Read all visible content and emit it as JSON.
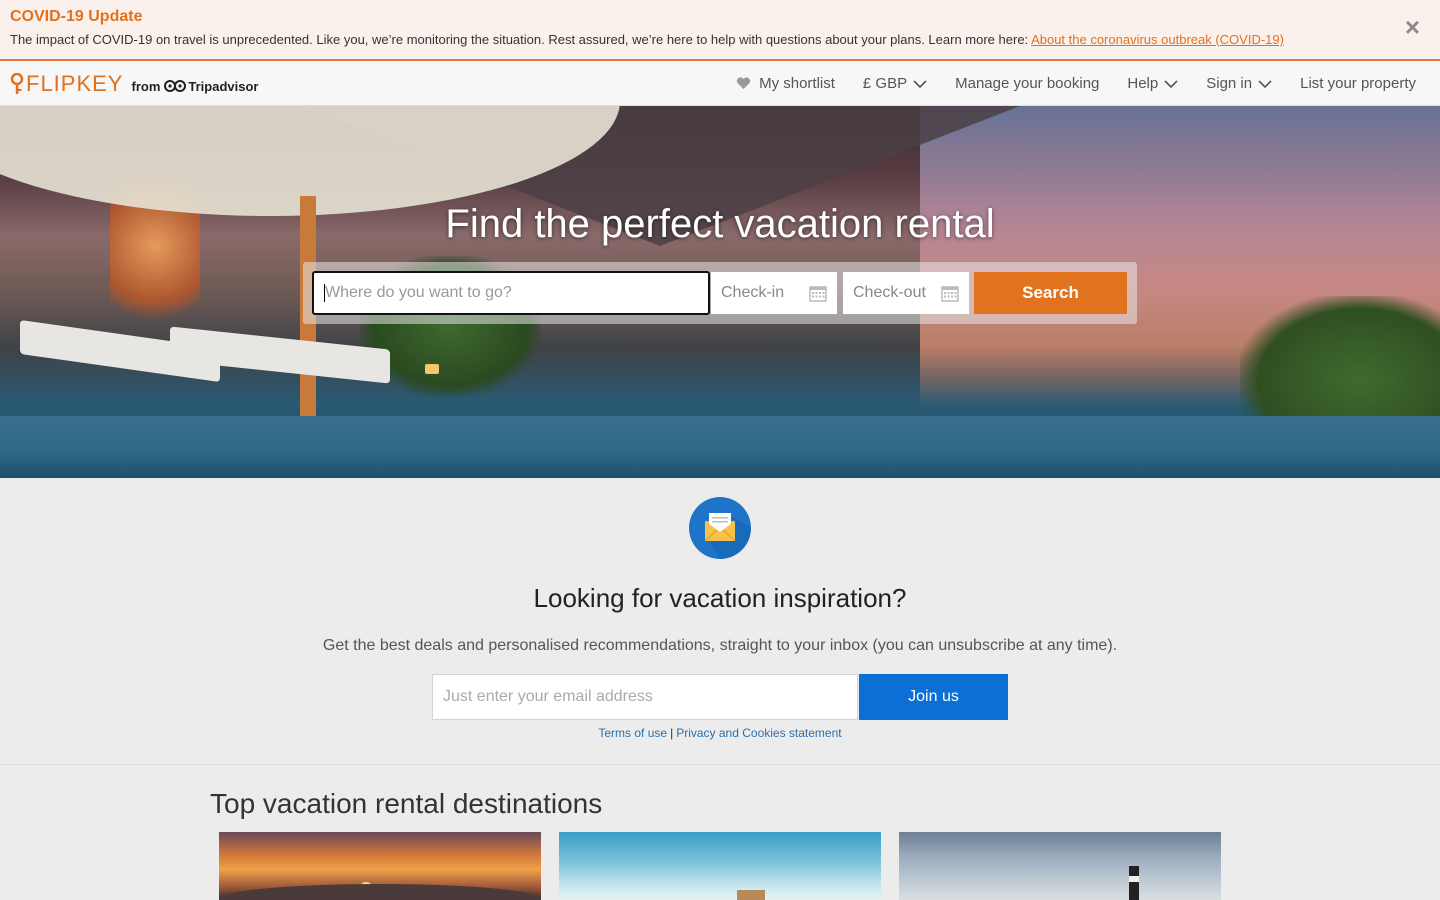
{
  "covid": {
    "title": "COVID-19 Update",
    "text": "The impact of COVID-19 on travel is unprecedented. Like you, we’re monitoring the situation. Rest assured, we’re here to help with questions about your plans. Learn more here: ",
    "link": "About the coronavirus outbreak (COVID-19)",
    "close": "×"
  },
  "header": {
    "logo": "FLIPKEY",
    "logo_from": "from",
    "logo_brand": "Tripadvisor",
    "nav": {
      "shortlist": "My shortlist",
      "currency": "£ GBP",
      "manage": "Manage your booking",
      "help": "Help",
      "signin": "Sign in",
      "list": "List your property"
    }
  },
  "hero": {
    "title": "Find the perfect vacation rental",
    "where_placeholder": "Where do you want to go?",
    "checkin": "Check-in",
    "checkout": "Check-out",
    "search": "Search"
  },
  "newsletter": {
    "title": "Looking for vacation inspiration?",
    "subtitle": "Get the best deals and personalised recommendations, straight to your inbox (you can unsubscribe at any time).",
    "email_placeholder": "Just enter your email address",
    "join": "Join us",
    "terms": "Terms of use",
    "separator": "|",
    "privacy": "Privacy and Cookies statement"
  },
  "destinations": {
    "title": "Top vacation rental destinations"
  },
  "colors": {
    "brand_orange": "#e2731e",
    "primary_blue": "#0b6fd6"
  }
}
